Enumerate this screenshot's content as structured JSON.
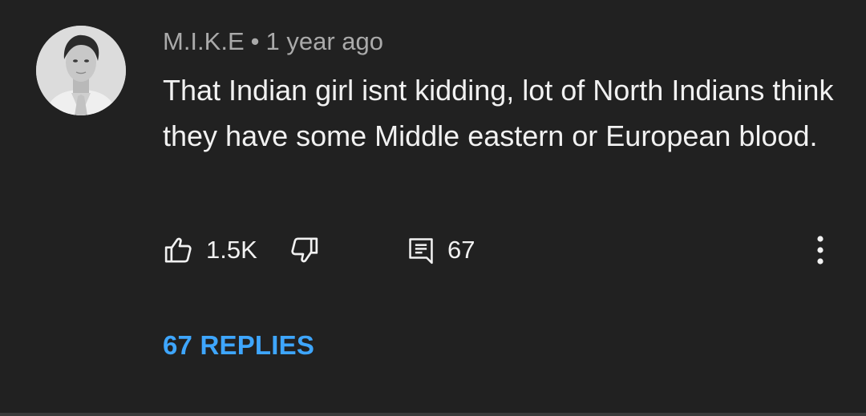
{
  "comment": {
    "author": "M.I.K.E",
    "separator": "•",
    "time_ago": "1 year ago",
    "text": "That Indian girl isnt kidding, lot of North Indians think they have some Middle eastern or European blood.",
    "like_count": "1.5K",
    "reply_count": "67",
    "replies_link": "67 REPLIES"
  },
  "icons": {
    "avatar": "avatar",
    "like": "thumbs-up-icon",
    "dislike": "thumbs-down-icon",
    "reply": "comment-icon",
    "more": "more-vertical-icon"
  },
  "colors": {
    "background": "#212121",
    "text_primary": "#f1f1f1",
    "text_secondary": "#aaaaaa",
    "link": "#3ea6ff"
  }
}
